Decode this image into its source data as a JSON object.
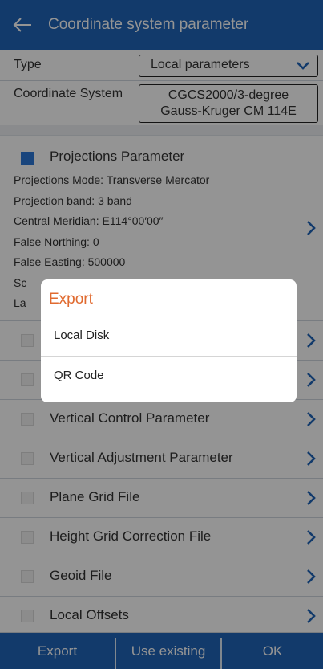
{
  "header": {
    "title": "Coordinate system parameter",
    "back_icon": "arrow-left-icon"
  },
  "form": {
    "type_label": "Type",
    "type_value": "Local parameters",
    "coordinate_system_label": "Coordinate System",
    "coordinate_system_value_line1": "CGCS2000/3-degree",
    "coordinate_system_value_line2": "Gauss-Kruger CM 114E"
  },
  "projections": {
    "checked": true,
    "title": "Projections Parameter",
    "mode": "Projections Mode: Transverse Mercator",
    "band": "Projection band: 3 band",
    "central_meridian": "Central Meridian: E114°00′00″",
    "false_northing": "False Northing: 0",
    "false_easting": "False Easting: 500000",
    "scale_partial": "Sc",
    "lat_partial": "La"
  },
  "list": [
    {
      "label": "",
      "checked": false
    },
    {
      "label": "",
      "checked": false
    },
    {
      "label": "Vertical Control Parameter",
      "checked": false
    },
    {
      "label": "Vertical Adjustment Parameter",
      "checked": false
    },
    {
      "label": "Plane Grid File",
      "checked": false
    },
    {
      "label": "Height Grid Correction File",
      "checked": false
    },
    {
      "label": "Geoid File",
      "checked": false
    },
    {
      "label": "Local Offsets",
      "checked": false
    }
  ],
  "dialog": {
    "title": "Export",
    "options": [
      "Local Disk",
      "QR Code"
    ]
  },
  "bottom_bar": {
    "export_label": "Export",
    "use_existing_label": "Use existing",
    "ok_label": "OK"
  },
  "colors": {
    "primary": "#1f64b8",
    "checkbox_checked": "#2b78d8",
    "dialog_title": "#e06a2f"
  }
}
